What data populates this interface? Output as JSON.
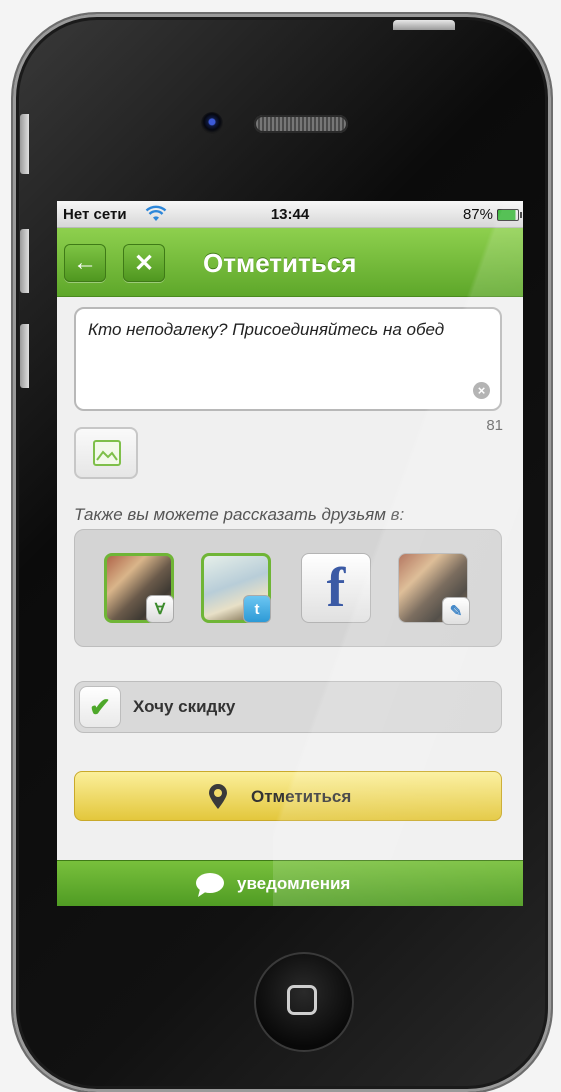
{
  "statusbar": {
    "carrier": "Нет сети",
    "time": "13:44",
    "battery": "87%",
    "battery_level": 0.87
  },
  "navbar": {
    "back_icon": "←",
    "close_icon": "✕",
    "title": "Отметиться"
  },
  "composer": {
    "text": "Кто неподалеку? Присоединяйтесь на обед",
    "remaining_chars": "81",
    "clear_icon": "×"
  },
  "share": {
    "label": "Также вы можете рассказать друзьям в:",
    "services": [
      {
        "icon": "vkontakte-photo-icon",
        "badge": "∀"
      },
      {
        "icon": "twitter-map-icon",
        "badge": "t"
      },
      {
        "icon": "facebook-icon",
        "glyph": "f"
      },
      {
        "icon": "photo-service-icon",
        "badge": "✎"
      }
    ]
  },
  "discount": {
    "check_icon": "✔",
    "label": "Хочу скидку"
  },
  "checkin_button": {
    "label": "Отметиться"
  },
  "notifications": {
    "label": "уведомления"
  },
  "colors": {
    "green": "#5ea72a",
    "yellow": "#e3c73c",
    "facebook": "#3b5aa5"
  }
}
